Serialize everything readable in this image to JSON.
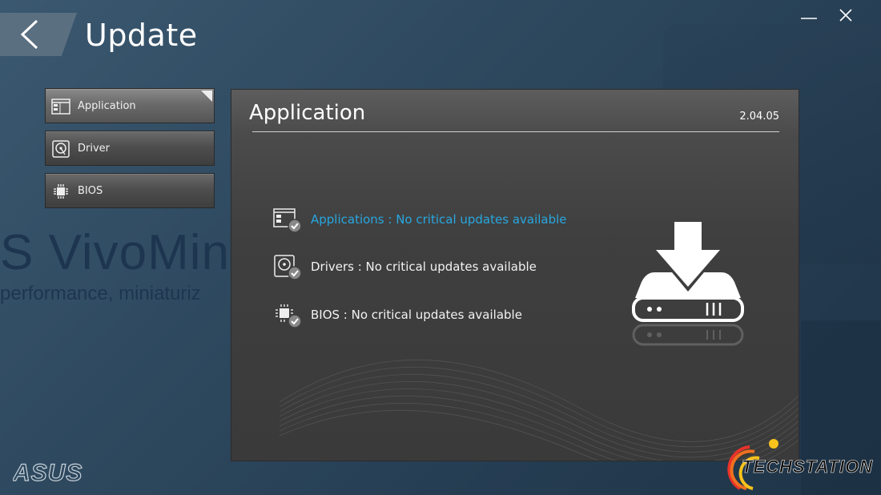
{
  "window": {
    "title": "Update",
    "brand_logo": "ASUS"
  },
  "background": {
    "brand_text": "S VivoMini",
    "tagline": "performance, miniaturiz"
  },
  "header": {
    "back_icon": "chevron-left-icon",
    "minimize_icon": "minimize-icon",
    "close_icon": "close-icon"
  },
  "sidebar": {
    "items": [
      {
        "label": "Application",
        "icon": "application-window-icon",
        "active": true
      },
      {
        "label": "Driver",
        "icon": "hard-disk-icon",
        "active": false
      },
      {
        "label": "BIOS",
        "icon": "chip-icon",
        "active": false
      }
    ]
  },
  "panel": {
    "title": "Application",
    "version": "2.04.05",
    "statuses": [
      {
        "text": "Applications : No critical updates available",
        "icon": "application-check-icon",
        "highlight": true
      },
      {
        "text": "Drivers : No critical updates available",
        "icon": "disk-check-icon",
        "highlight": false
      },
      {
        "text": "BIOS : No critical updates available",
        "icon": "chip-check-icon",
        "highlight": false
      }
    ],
    "hero_icon": "download-drive-icon"
  },
  "watermark": {
    "text": "TECHSTATION"
  },
  "colors": {
    "highlight": "#27a7e0",
    "background": "#2f4a60",
    "panel": "#3f3f3f"
  }
}
